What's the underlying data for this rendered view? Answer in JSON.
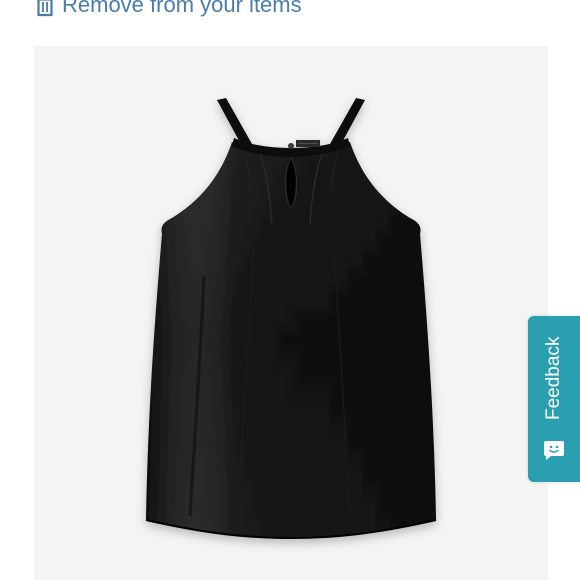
{
  "header": {
    "remove_label": "Remove from your items",
    "remove_icon": "trash-icon"
  },
  "product": {
    "image_alt": "Black sleeveless halter top",
    "garment_color": "#121212",
    "background_color": "#f4f4f5"
  },
  "feedback": {
    "label": "Feedback",
    "icon": "chat-bubble-icon",
    "accent": "#2a9fb0"
  },
  "colors": {
    "link": "#4a7dab"
  }
}
